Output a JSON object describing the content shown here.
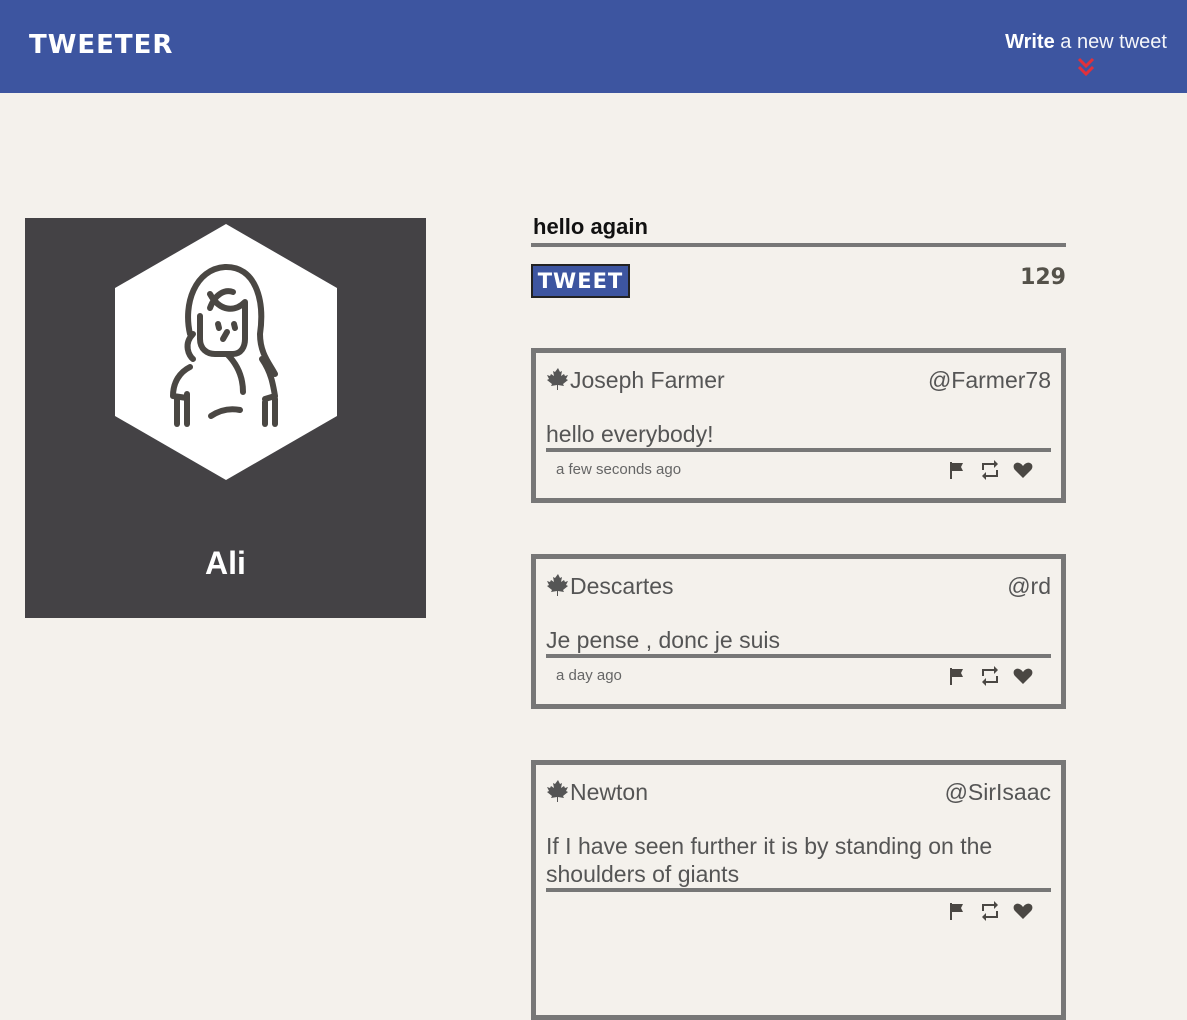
{
  "nav": {
    "logo": "TWEETER",
    "compose_bold": "Write",
    "compose_rest": " a new tweet",
    "chevron_icon": "double-chevron-down-icon",
    "background_color": "#3d55a0",
    "accent_color": "#e2303a"
  },
  "profile": {
    "name": "Ali",
    "avatar_icon": "user-avatar-icon",
    "background_color": "#444245"
  },
  "composer": {
    "value": "hello again",
    "button_label": "TWEET",
    "counter": "129"
  },
  "tweets": [
    {
      "name": "Joseph Farmer",
      "handle": "@Farmer78",
      "text": "hello everybody!",
      "time": "a few seconds ago"
    },
    {
      "name": "Descartes",
      "handle": "@rd",
      "text": "Je pense , donc je suis",
      "time": "a day ago"
    },
    {
      "name": "Newton",
      "handle": "@SirIsaac",
      "text": "If I have seen further it is by standing on the shoulders of giants",
      "time": ""
    }
  ],
  "tweet_icons": [
    "maple-leaf-icon",
    "flag-icon",
    "retweet-icon",
    "heart-icon"
  ]
}
